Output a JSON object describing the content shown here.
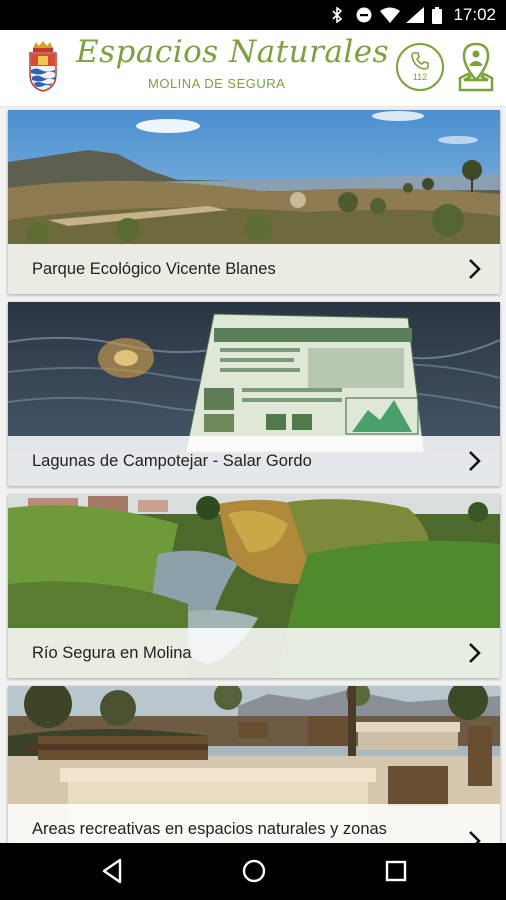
{
  "status": {
    "time": "17:02"
  },
  "header": {
    "title": "Espacios Naturales",
    "subtitle": "MOLINA DE SEGURA",
    "emergency_number": "112",
    "brand_color": "#7aa33a"
  },
  "places": [
    {
      "label": "Parque Ecológico Vicente Blanes"
    },
    {
      "label": "Lagunas de Campotejar - Salar Gordo"
    },
    {
      "label": "Río Segura en Molina"
    },
    {
      "label": "Areas recreativas en espacios naturales y zonas verdes"
    }
  ],
  "nav": {
    "back": "back-icon",
    "home": "home-icon",
    "recents": "recents-icon"
  }
}
